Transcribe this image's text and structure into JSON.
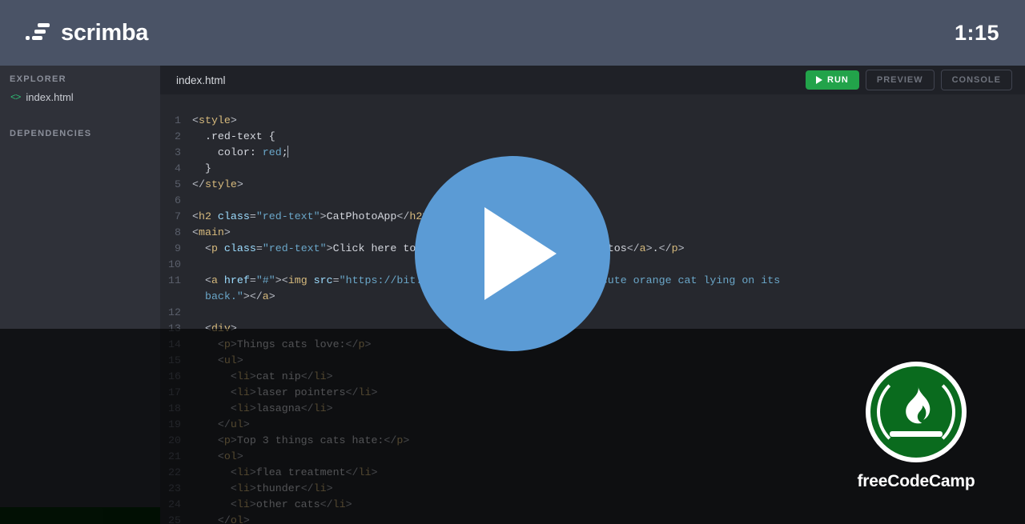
{
  "header": {
    "brand_name": "scrimba",
    "brand_icon": "scrimba-logo-icon",
    "timer": "1:15"
  },
  "sidebar": {
    "explorer_title": "EXPLORER",
    "files": [
      {
        "icon": "code-brackets-icon",
        "icon_glyph": "<>",
        "label": "index.html"
      }
    ],
    "dependencies_title": "DEPENDENCIES"
  },
  "tabbar": {
    "tab_label": "index.html",
    "run_label": "RUN",
    "run_icon": "play-triangle-icon",
    "preview_label": "PREVIEW",
    "console_label": "CONSOLE",
    "run_color": "#22a34a"
  },
  "player": {
    "play_icon": "play-circle-icon",
    "color": "#5b9bd5"
  },
  "watermark": {
    "name": "freeCodeCamp",
    "logo_icon": "freecodecamp-flame-icon",
    "color": "#0a6b1e"
  },
  "editor": {
    "cursor_line": 3,
    "lines": [
      {
        "n": "1",
        "segments": [
          {
            "t": "punct",
            "s": "<"
          },
          {
            "t": "tag",
            "s": "style"
          },
          {
            "t": "punct",
            "s": ">"
          }
        ]
      },
      {
        "n": "2",
        "segments": [
          {
            "t": "txt",
            "s": "  .red-text {"
          }
        ]
      },
      {
        "n": "3",
        "segments": [
          {
            "t": "txt",
            "s": "    color: "
          },
          {
            "t": "val",
            "s": "red"
          },
          {
            "t": "txt",
            "s": ";"
          }
        ],
        "cursor": true
      },
      {
        "n": "4",
        "segments": [
          {
            "t": "txt",
            "s": "  }"
          }
        ]
      },
      {
        "n": "5",
        "segments": [
          {
            "t": "punct",
            "s": "</"
          },
          {
            "t": "tag",
            "s": "style"
          },
          {
            "t": "punct",
            "s": ">"
          }
        ]
      },
      {
        "n": "6",
        "segments": [
          {
            "t": "txt",
            "s": ""
          }
        ]
      },
      {
        "n": "7",
        "segments": [
          {
            "t": "punct",
            "s": "<"
          },
          {
            "t": "tag",
            "s": "h2"
          },
          {
            "t": "attr",
            "s": " class"
          },
          {
            "t": "punct",
            "s": "="
          },
          {
            "t": "str",
            "s": "\"red-text\""
          },
          {
            "t": "punct",
            "s": ">"
          },
          {
            "t": "txt",
            "s": "CatPhotoApp"
          },
          {
            "t": "punct",
            "s": "</"
          },
          {
            "t": "tag",
            "s": "h2"
          },
          {
            "t": "punct",
            "s": ">"
          }
        ]
      },
      {
        "n": "8",
        "segments": [
          {
            "t": "punct",
            "s": "<"
          },
          {
            "t": "tag",
            "s": "main"
          },
          {
            "t": "punct",
            "s": ">"
          }
        ]
      },
      {
        "n": "9",
        "segments": [
          {
            "t": "txt",
            "s": "  "
          },
          {
            "t": "punct",
            "s": "<"
          },
          {
            "t": "tag",
            "s": "p"
          },
          {
            "t": "attr",
            "s": " class"
          },
          {
            "t": "punct",
            "s": "="
          },
          {
            "t": "str",
            "s": "\"red-text\""
          },
          {
            "t": "punct",
            "s": ">"
          },
          {
            "t": "txt",
            "s": "Click here to view more "
          },
          {
            "t": "punct",
            "s": "<"
          },
          {
            "t": "tag",
            "s": "a"
          },
          {
            "t": "attr",
            "s": " href"
          },
          {
            "t": "punct",
            "s": "="
          },
          {
            "t": "str",
            "s": "\"#\""
          },
          {
            "t": "punct",
            "s": ">"
          },
          {
            "t": "txt",
            "s": "cat photos"
          },
          {
            "t": "punct",
            "s": "</"
          },
          {
            "t": "tag",
            "s": "a"
          },
          {
            "t": "punct",
            "s": ">"
          },
          {
            "t": "txt",
            "s": "."
          },
          {
            "t": "punct",
            "s": "</"
          },
          {
            "t": "tag",
            "s": "p"
          },
          {
            "t": "punct",
            "s": ">"
          }
        ]
      },
      {
        "n": "10",
        "segments": [
          {
            "t": "txt",
            "s": ""
          }
        ]
      },
      {
        "n": "11",
        "segments": [
          {
            "t": "txt",
            "s": "  "
          },
          {
            "t": "punct",
            "s": "<"
          },
          {
            "t": "tag",
            "s": "a"
          },
          {
            "t": "attr",
            "s": " href"
          },
          {
            "t": "punct",
            "s": "="
          },
          {
            "t": "str",
            "s": "\"#\""
          },
          {
            "t": "punct",
            "s": ">"
          },
          {
            "t": "punct",
            "s": "<"
          },
          {
            "t": "tag",
            "s": "img"
          },
          {
            "t": "attr",
            "s": " src"
          },
          {
            "t": "punct",
            "s": "="
          },
          {
            "t": "str",
            "s": "\"https://bit.ly/fcc-relaxing-cat\""
          },
          {
            "t": "attr",
            "s": " alt"
          },
          {
            "t": "punct",
            "s": "="
          },
          {
            "t": "str",
            "s": "\"A cute orange cat lying on its"
          }
        ]
      },
      {
        "n": "",
        "segments": [
          {
            "t": "str",
            "s": "  back.\""
          },
          {
            "t": "punct",
            "s": "></"
          },
          {
            "t": "tag",
            "s": "a"
          },
          {
            "t": "punct",
            "s": ">"
          }
        ],
        "cont": true
      },
      {
        "n": "12",
        "segments": [
          {
            "t": "txt",
            "s": ""
          }
        ]
      },
      {
        "n": "13",
        "segments": [
          {
            "t": "txt",
            "s": "  "
          },
          {
            "t": "punct",
            "s": "<"
          },
          {
            "t": "tag",
            "s": "div"
          },
          {
            "t": "punct",
            "s": ">"
          }
        ]
      },
      {
        "n": "14",
        "segments": [
          {
            "t": "txt",
            "s": "    "
          },
          {
            "t": "punct",
            "s": "<"
          },
          {
            "t": "tag",
            "s": "p"
          },
          {
            "t": "punct",
            "s": ">"
          },
          {
            "t": "txt",
            "s": "Things cats love:"
          },
          {
            "t": "punct",
            "s": "</"
          },
          {
            "t": "tag",
            "s": "p"
          },
          {
            "t": "punct",
            "s": ">"
          }
        ]
      },
      {
        "n": "15",
        "segments": [
          {
            "t": "txt",
            "s": "    "
          },
          {
            "t": "punct",
            "s": "<"
          },
          {
            "t": "tag",
            "s": "ul"
          },
          {
            "t": "punct",
            "s": ">"
          }
        ]
      },
      {
        "n": "16",
        "segments": [
          {
            "t": "txt",
            "s": "      "
          },
          {
            "t": "punct",
            "s": "<"
          },
          {
            "t": "tag",
            "s": "li"
          },
          {
            "t": "punct",
            "s": ">"
          },
          {
            "t": "txt",
            "s": "cat nip"
          },
          {
            "t": "punct",
            "s": "</"
          },
          {
            "t": "tag",
            "s": "li"
          },
          {
            "t": "punct",
            "s": ">"
          }
        ]
      },
      {
        "n": "17",
        "segments": [
          {
            "t": "txt",
            "s": "      "
          },
          {
            "t": "punct",
            "s": "<"
          },
          {
            "t": "tag",
            "s": "li"
          },
          {
            "t": "punct",
            "s": ">"
          },
          {
            "t": "txt",
            "s": "laser pointers"
          },
          {
            "t": "punct",
            "s": "</"
          },
          {
            "t": "tag",
            "s": "li"
          },
          {
            "t": "punct",
            "s": ">"
          }
        ]
      },
      {
        "n": "18",
        "segments": [
          {
            "t": "txt",
            "s": "      "
          },
          {
            "t": "punct",
            "s": "<"
          },
          {
            "t": "tag",
            "s": "li"
          },
          {
            "t": "punct",
            "s": ">"
          },
          {
            "t": "txt",
            "s": "lasagna"
          },
          {
            "t": "punct",
            "s": "</"
          },
          {
            "t": "tag",
            "s": "li"
          },
          {
            "t": "punct",
            "s": ">"
          }
        ]
      },
      {
        "n": "19",
        "segments": [
          {
            "t": "txt",
            "s": "    "
          },
          {
            "t": "punct",
            "s": "</"
          },
          {
            "t": "tag",
            "s": "ul"
          },
          {
            "t": "punct",
            "s": ">"
          }
        ]
      },
      {
        "n": "20",
        "segments": [
          {
            "t": "txt",
            "s": "    "
          },
          {
            "t": "punct",
            "s": "<"
          },
          {
            "t": "tag",
            "s": "p"
          },
          {
            "t": "punct",
            "s": ">"
          },
          {
            "t": "txt",
            "s": "Top 3 things cats hate:"
          },
          {
            "t": "punct",
            "s": "</"
          },
          {
            "t": "tag",
            "s": "p"
          },
          {
            "t": "punct",
            "s": ">"
          }
        ]
      },
      {
        "n": "21",
        "segments": [
          {
            "t": "txt",
            "s": "    "
          },
          {
            "t": "punct",
            "s": "<"
          },
          {
            "t": "tag",
            "s": "ol"
          },
          {
            "t": "punct",
            "s": ">"
          }
        ]
      },
      {
        "n": "22",
        "segments": [
          {
            "t": "txt",
            "s": "      "
          },
          {
            "t": "punct",
            "s": "<"
          },
          {
            "t": "tag",
            "s": "li"
          },
          {
            "t": "punct",
            "s": ">"
          },
          {
            "t": "txt",
            "s": "flea treatment"
          },
          {
            "t": "punct",
            "s": "</"
          },
          {
            "t": "tag",
            "s": "li"
          },
          {
            "t": "punct",
            "s": ">"
          }
        ]
      },
      {
        "n": "23",
        "segments": [
          {
            "t": "txt",
            "s": "      "
          },
          {
            "t": "punct",
            "s": "<"
          },
          {
            "t": "tag",
            "s": "li"
          },
          {
            "t": "punct",
            "s": ">"
          },
          {
            "t": "txt",
            "s": "thunder"
          },
          {
            "t": "punct",
            "s": "</"
          },
          {
            "t": "tag",
            "s": "li"
          },
          {
            "t": "punct",
            "s": ">"
          }
        ]
      },
      {
        "n": "24",
        "segments": [
          {
            "t": "txt",
            "s": "      "
          },
          {
            "t": "punct",
            "s": "<"
          },
          {
            "t": "tag",
            "s": "li"
          },
          {
            "t": "punct",
            "s": ">"
          },
          {
            "t": "txt",
            "s": "other cats"
          },
          {
            "t": "punct",
            "s": "</"
          },
          {
            "t": "tag",
            "s": "li"
          },
          {
            "t": "punct",
            "s": ">"
          }
        ]
      },
      {
        "n": "25",
        "segments": [
          {
            "t": "txt",
            "s": "    "
          },
          {
            "t": "punct",
            "s": "</"
          },
          {
            "t": "tag",
            "s": "ol"
          },
          {
            "t": "punct",
            "s": ">"
          }
        ]
      }
    ]
  }
}
